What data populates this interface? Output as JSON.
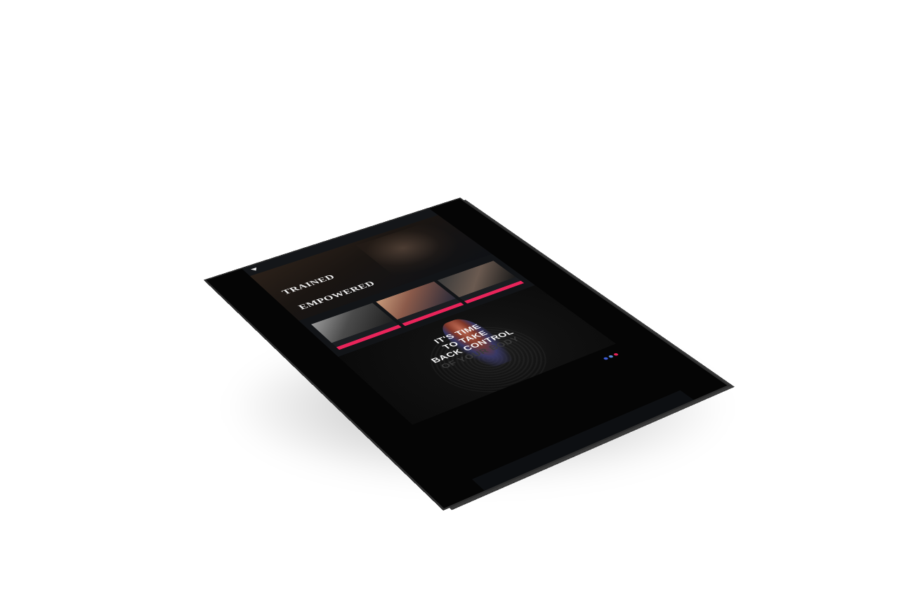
{
  "hero": {
    "words": [
      "TRAINED",
      "EMPOWERED"
    ]
  },
  "cta": {
    "lines": [
      "IT'S TIME",
      "TO TAKE",
      "BACK CONTROL",
      "OF YOUR BODY"
    ]
  },
  "colors": {
    "accent": "#e8245a",
    "background": "#0d0f12",
    "page": "#ffffff"
  },
  "icons": {
    "logo": "v-shield-icon",
    "socials": [
      "facebook-icon",
      "instagram-icon",
      "youtube-icon"
    ]
  }
}
